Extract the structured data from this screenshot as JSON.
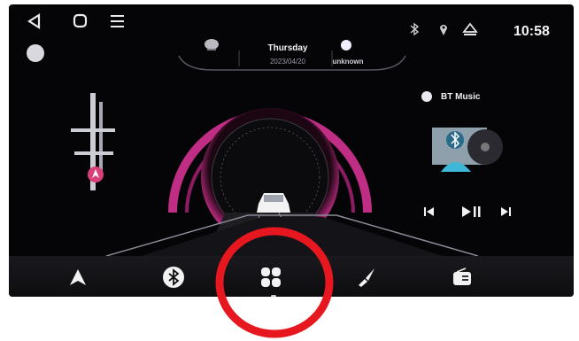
{
  "weather": {
    "day": "Thursday",
    "date": "2023/04/20",
    "location": "unknown"
  },
  "status_bar": {
    "time": "10:58",
    "icons": [
      "bluetooth-icon",
      "location-pin-icon",
      "eject-icon"
    ]
  },
  "nav_bar": {
    "icons": [
      "back-icon",
      "home-icon",
      "menu-icon"
    ]
  },
  "music": {
    "title": "BT Music",
    "controls": [
      "previous-icon",
      "play-pause-icon",
      "next-icon"
    ]
  },
  "dock": {
    "items": [
      "navigation-icon",
      "bluetooth-icon",
      "apps-icon",
      "brush-icon",
      "radio-icon"
    ],
    "active_index": 2
  },
  "annotation": {
    "color": "#e6171f"
  },
  "colors": {
    "accent": "#e0359a",
    "background": "#050507"
  }
}
